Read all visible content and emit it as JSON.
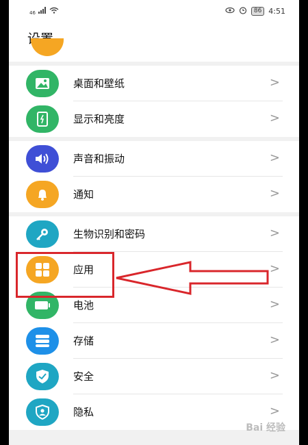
{
  "status_bar": {
    "signal_text": "46",
    "battery": "86",
    "time": "4:51"
  },
  "page": {
    "title": "设置"
  },
  "groups": [
    {
      "items": [
        {
          "label": "桌面和壁纸",
          "icon": "wallpaper-icon",
          "color": "#31b566"
        },
        {
          "label": "显示和亮度",
          "icon": "display-icon",
          "color": "#31b566"
        }
      ]
    },
    {
      "items": [
        {
          "label": "声音和振动",
          "icon": "volume-icon",
          "color": "#3f4fd6"
        },
        {
          "label": "通知",
          "icon": "bell-icon",
          "color": "#f5a623"
        }
      ]
    },
    {
      "items": [
        {
          "label": "生物识别和密码",
          "icon": "key-icon",
          "color": "#1fa6c3"
        },
        {
          "label": "应用",
          "icon": "apps-icon",
          "color": "#f5a623"
        },
        {
          "label": "电池",
          "icon": "battery-icon",
          "color": "#31b566"
        },
        {
          "label": "存储",
          "icon": "storage-icon",
          "color": "#1e90e8"
        },
        {
          "label": "安全",
          "icon": "shield-icon",
          "color": "#1fa6c3"
        },
        {
          "label": "隐私",
          "icon": "privacy-icon",
          "color": "#1fa6c3"
        }
      ]
    }
  ],
  "chevron": ">",
  "annotation": {
    "box_color": "#d9262b"
  },
  "watermark": "Bai 经验"
}
